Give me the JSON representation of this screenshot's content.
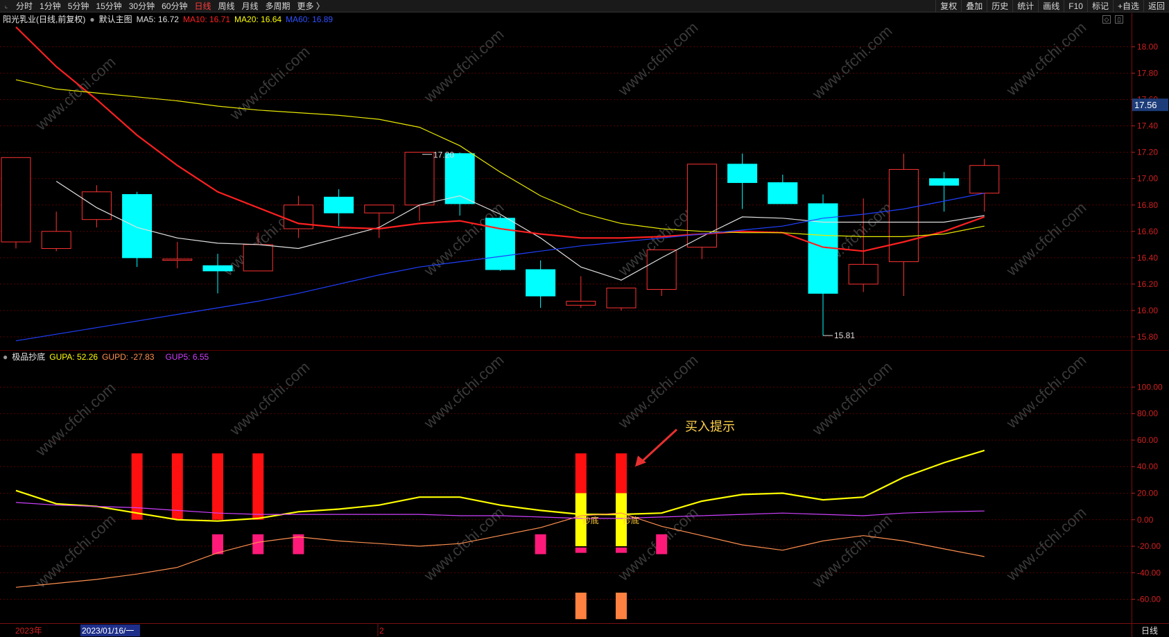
{
  "toolbar": {
    "periods": [
      {
        "label": "分时",
        "active": false
      },
      {
        "label": "1分钟",
        "active": false
      },
      {
        "label": "5分钟",
        "active": false
      },
      {
        "label": "15分钟",
        "active": false
      },
      {
        "label": "30分钟",
        "active": false
      },
      {
        "label": "60分钟",
        "active": false
      },
      {
        "label": "日线",
        "active": true
      },
      {
        "label": "周线",
        "active": false
      },
      {
        "label": "月线",
        "active": false
      },
      {
        "label": "多周期",
        "active": false
      },
      {
        "label": "更多 〉",
        "active": false
      }
    ],
    "right_buttons": [
      "复权",
      "叠加",
      "历史",
      "统计",
      "画线",
      "F10",
      "标记",
      "+自选",
      "返回"
    ]
  },
  "main_info": {
    "stock": "阳光乳业(日线,前复权)",
    "template": "默认主图",
    "ma": [
      {
        "label": "MA5: 16.72",
        "color": "#e0e0e0"
      },
      {
        "label": "MA10: 16.71",
        "color": "#ff2020"
      },
      {
        "label": "MA20: 16.64",
        "color": "#ffff00"
      },
      {
        "label": "MA60: 16.89",
        "color": "#3050ff"
      }
    ]
  },
  "sub_info": {
    "indicator": "极品抄底",
    "items": [
      {
        "label": "GUPA: 52.26",
        "color": "#ffff00"
      },
      {
        "label": "GUPD: -27.83",
        "color": "#ff9050"
      },
      {
        "label": "GUP5: 6.55",
        "color": "#d040ff"
      }
    ]
  },
  "price_axis": {
    "ticks": [
      "18.00",
      "17.80",
      "17.60",
      "17.40",
      "17.20",
      "17.00",
      "16.80",
      "16.60",
      "16.40",
      "16.20",
      "16.00",
      "15.80"
    ],
    "current_price": "17.56",
    "range": [
      15.7,
      18.15
    ]
  },
  "indicator_axis": {
    "ticks": [
      "100.00",
      "80.00",
      "60.00",
      "40.00",
      "20.00",
      "0.00",
      "-20.00",
      "-40.00",
      "-60.00"
    ],
    "range": [
      -78,
      118
    ]
  },
  "annotations": {
    "high_label": "17.20",
    "low_label": "15.81",
    "buy_hint": "买入提示",
    "bottom_text": "抄底"
  },
  "date_bar": {
    "year": "2023年",
    "date": "2023/01/16/一",
    "month": "2",
    "period_label": "日线"
  },
  "watermark": "www.cfchi.com",
  "colors": {
    "up": "#ff3232",
    "down": "#00ffff",
    "ma5": "#e0e0e0",
    "ma10": "#ff2020",
    "ma20": "#e8e800",
    "ma60": "#2040ff",
    "gupa": "#ffff00",
    "gupd": "#ff9050",
    "gup5": "#d040ff",
    "bar_red": "#ff1010",
    "bar_yellow": "#ffff00",
    "bar_pink": "#ff1a7a",
    "bar_orange": "#ff8040"
  },
  "chart_data": [
    {
      "type": "candlestick",
      "title": "阳光乳业(日线,前复权)",
      "ylim": [
        15.7,
        18.15
      ],
      "candles": [
        {
          "open": 16.52,
          "close": 17.16,
          "high": 17.16,
          "low": 16.47
        },
        {
          "open": 16.47,
          "close": 16.6,
          "high": 16.75,
          "low": 16.45
        },
        {
          "open": 16.69,
          "close": 16.9,
          "high": 16.95,
          "low": 16.63
        },
        {
          "open": 16.88,
          "close": 16.4,
          "high": 16.9,
          "low": 16.33
        },
        {
          "open": 16.38,
          "close": 16.39,
          "high": 16.52,
          "low": 16.32
        },
        {
          "open": 16.34,
          "close": 16.3,
          "high": 16.43,
          "low": 16.13
        },
        {
          "open": 16.3,
          "close": 16.5,
          "high": 16.59,
          "low": 16.3
        },
        {
          "open": 16.62,
          "close": 16.8,
          "high": 16.87,
          "low": 16.55
        },
        {
          "open": 16.86,
          "close": 16.74,
          "high": 16.92,
          "low": 16.64
        },
        {
          "open": 16.74,
          "close": 16.8,
          "high": 16.8,
          "low": 16.55
        },
        {
          "open": 16.8,
          "close": 17.2,
          "high": 17.2,
          "low": 16.68
        },
        {
          "open": 17.19,
          "close": 16.81,
          "high": 17.2,
          "low": 16.72
        },
        {
          "open": 16.7,
          "close": 16.31,
          "high": 16.72,
          "low": 16.3
        },
        {
          "open": 16.31,
          "close": 16.11,
          "high": 16.38,
          "low": 16.02
        },
        {
          "open": 16.04,
          "close": 16.07,
          "high": 16.26,
          "low": 16.02
        },
        {
          "open": 16.02,
          "close": 16.17,
          "high": 16.17,
          "low": 16.0
        },
        {
          "open": 16.16,
          "close": 16.46,
          "high": 16.46,
          "low": 16.11
        },
        {
          "open": 16.48,
          "close": 17.11,
          "high": 17.11,
          "low": 16.39
        },
        {
          "open": 17.11,
          "close": 16.97,
          "high": 17.19,
          "low": 16.77
        },
        {
          "open": 16.97,
          "close": 16.81,
          "high": 17.03,
          "low": 16.81
        },
        {
          "open": 16.81,
          "close": 16.13,
          "high": 16.88,
          "low": 15.81
        },
        {
          "open": 16.2,
          "close": 16.35,
          "high": 16.85,
          "low": 16.14
        },
        {
          "open": 16.37,
          "close": 17.07,
          "high": 17.19,
          "low": 16.11
        },
        {
          "open": 17.0,
          "close": 16.95,
          "high": 17.05,
          "low": 16.75
        },
        {
          "open": 16.89,
          "close": 17.1,
          "high": 17.15,
          "low": 16.75
        }
      ],
      "series": [
        {
          "name": "MA5",
          "values": [
            16.98,
            16.78,
            16.63,
            16.55,
            16.51,
            16.5,
            16.47,
            16.55,
            16.63,
            16.8,
            16.87,
            16.73,
            16.55,
            16.33,
            16.23,
            16.4,
            16.56,
            16.71,
            16.7,
            16.67,
            16.67,
            16.67,
            16.67,
            16.72
          ]
        },
        {
          "name": "MA10",
          "values": [
            18.15,
            17.85,
            17.6,
            17.33,
            17.1,
            16.9,
            16.78,
            16.66,
            16.63,
            16.62,
            16.66,
            16.68,
            16.62,
            16.58,
            16.55,
            16.55,
            16.56,
            16.58,
            16.6,
            16.59,
            16.48,
            16.45,
            16.52,
            16.6,
            16.71
          ]
        },
        {
          "name": "MA20",
          "values": [
            17.75,
            17.68,
            17.65,
            17.62,
            17.59,
            17.55,
            17.52,
            17.5,
            17.48,
            17.45,
            17.39,
            17.25,
            17.05,
            16.87,
            16.74,
            16.66,
            16.62,
            16.6,
            16.59,
            16.59,
            16.57,
            16.56,
            16.56,
            16.58,
            16.64
          ]
        },
        {
          "name": "MA60",
          "values": [
            15.77,
            15.82,
            15.87,
            15.92,
            15.97,
            16.02,
            16.07,
            16.13,
            16.2,
            16.27,
            16.33,
            16.37,
            16.41,
            16.45,
            16.49,
            16.52,
            16.55,
            16.58,
            16.61,
            16.64,
            16.7,
            16.73,
            16.77,
            16.83,
            16.89
          ]
        }
      ]
    },
    {
      "type": "bar",
      "title": "极品抄底",
      "ylim": [
        -78,
        118
      ],
      "series": [
        {
          "name": "GUPA",
          "values": [
            22,
            12,
            10,
            5,
            0,
            -1,
            1,
            6,
            8,
            11,
            17,
            17,
            11,
            7,
            4,
            4,
            5,
            14,
            19,
            20,
            15,
            17,
            32,
            43,
            52.26
          ]
        },
        {
          "name": "GUPD",
          "values": [
            -51,
            -48,
            -45,
            -41,
            -36,
            -25,
            -17,
            -13,
            -16,
            -18,
            -20,
            -18,
            -12,
            -6,
            3,
            5,
            -5,
            -12,
            -19,
            -23,
            -16,
            -12,
            -16,
            -22,
            -27.83
          ]
        },
        {
          "name": "GUP5",
          "values": [
            13,
            11,
            10,
            9,
            7,
            5,
            4,
            4,
            4,
            4,
            4,
            3,
            3,
            2,
            1,
            1,
            2,
            3,
            4,
            5,
            4,
            3,
            5,
            6,
            6.55
          ]
        }
      ],
      "bars": [
        {
          "index": 3,
          "color": "red",
          "from": 0,
          "to": 50
        },
        {
          "index": 4,
          "color": "red",
          "from": 0,
          "to": 50
        },
        {
          "index": 5,
          "color": "red",
          "from": 0,
          "to": 50
        },
        {
          "index": 6,
          "color": "red",
          "from": 0,
          "to": 50
        },
        {
          "index": 14,
          "color": "red",
          "from": 20,
          "to": 50
        },
        {
          "index": 14,
          "color": "yellow",
          "from": -20,
          "to": 20
        },
        {
          "index": 15,
          "color": "red",
          "from": 20,
          "to": 50
        },
        {
          "index": 15,
          "color": "yellow",
          "from": -20,
          "to": 20
        },
        {
          "index": 5,
          "color": "pink",
          "from": -26,
          "to": -11
        },
        {
          "index": 6,
          "color": "pink",
          "from": -26,
          "to": -11
        },
        {
          "index": 7,
          "color": "pink",
          "from": -26,
          "to": -11
        },
        {
          "index": 13,
          "color": "pink",
          "from": -26,
          "to": -11
        },
        {
          "index": 14,
          "color": "pink",
          "from": -25,
          "to": -21
        },
        {
          "index": 15,
          "color": "pink",
          "from": -25,
          "to": -21
        },
        {
          "index": 16,
          "color": "pink",
          "from": -26,
          "to": -11
        },
        {
          "index": 14,
          "color": "orange",
          "from": -75,
          "to": -55
        },
        {
          "index": 15,
          "color": "orange",
          "from": -75,
          "to": -55
        }
      ]
    }
  ]
}
